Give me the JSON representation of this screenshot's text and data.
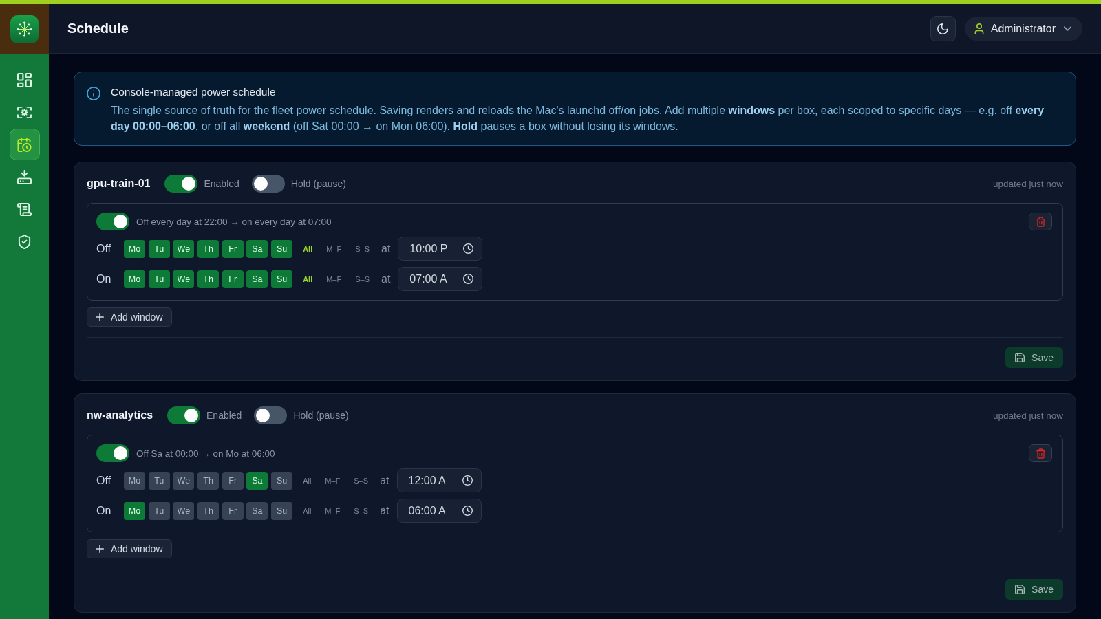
{
  "header": {
    "title": "Schedule",
    "user": {
      "name": "Administrator"
    }
  },
  "sidebar": {
    "items": [
      {
        "selected": false
      },
      {
        "selected": false
      },
      {
        "selected": true
      },
      {
        "selected": false
      },
      {
        "selected": false
      },
      {
        "selected": false
      }
    ]
  },
  "notice": {
    "title": "Console-managed power schedule",
    "text": "The single source of truth for the fleet power schedule. Saving renders and reloads the Mac's launchd off/on jobs. Add multiple **windows** per box, each scoped to specific days — e.g. off **every day 00:00–06:00**, or off all **weekend** (off Sat 00:00 → on Mon 06:00). **Hold** pauses a box without losing its windows."
  },
  "machines": [
    {
      "name": "gpu-train-01",
      "enabled": true,
      "enabled_label": "Enabled",
      "hold": false,
      "hold_label": "Hold (pause)",
      "updated": "updated just now",
      "windows": [
        {
          "active": true,
          "summary": "Off every day at 22:00 → on every day at 07:00",
          "rules": [
            {
              "label": "Off",
              "days": [
                {
                  "label": "Mo",
                  "selected": true
                },
                {
                  "label": "Tu",
                  "selected": true
                },
                {
                  "label": "We",
                  "selected": true
                },
                {
                  "label": "Th",
                  "selected": true
                },
                {
                  "label": "Fr",
                  "selected": true
                },
                {
                  "label": "Sa",
                  "selected": true
                },
                {
                  "label": "Su",
                  "selected": true
                }
              ],
              "presets": [
                {
                  "label": "All",
                  "selected": true
                },
                {
                  "label": "M–F",
                  "selected": false
                },
                {
                  "label": "S–S",
                  "selected": false
                }
              ],
              "at": "at",
              "time": "10:00 P"
            },
            {
              "label": "On",
              "days": [
                {
                  "label": "Mo",
                  "selected": true
                },
                {
                  "label": "Tu",
                  "selected": true
                },
                {
                  "label": "We",
                  "selected": true
                },
                {
                  "label": "Th",
                  "selected": true
                },
                {
                  "label": "Fr",
                  "selected": true
                },
                {
                  "label": "Sa",
                  "selected": true
                },
                {
                  "label": "Su",
                  "selected": true
                }
              ],
              "presets": [
                {
                  "label": "All",
                  "selected": true
                },
                {
                  "label": "M–F",
                  "selected": false
                },
                {
                  "label": "S–S",
                  "selected": false
                }
              ],
              "at": "at",
              "time": "07:00 A"
            }
          ]
        }
      ],
      "add_button": "Add window",
      "save_button": "Save"
    },
    {
      "name": "nw-analytics",
      "enabled": true,
      "enabled_label": "Enabled",
      "hold": false,
      "hold_label": "Hold (pause)",
      "updated": "updated just now",
      "windows": [
        {
          "active": true,
          "summary": "Off Sa at 00:00 → on Mo at 06:00",
          "rules": [
            {
              "label": "Off",
              "days": [
                {
                  "label": "Mo",
                  "selected": false
                },
                {
                  "label": "Tu",
                  "selected": false
                },
                {
                  "label": "We",
                  "selected": false
                },
                {
                  "label": "Th",
                  "selected": false
                },
                {
                  "label": "Fr",
                  "selected": false
                },
                {
                  "label": "Sa",
                  "selected": true
                },
                {
                  "label": "Su",
                  "selected": false
                }
              ],
              "presets": [
                {
                  "label": "All",
                  "selected": false
                },
                {
                  "label": "M–F",
                  "selected": false
                },
                {
                  "label": "S–S",
                  "selected": false
                }
              ],
              "at": "at",
              "time": "12:00 A"
            },
            {
              "label": "On",
              "days": [
                {
                  "label": "Mo",
                  "selected": true
                },
                {
                  "label": "Tu",
                  "selected": false
                },
                {
                  "label": "We",
                  "selected": false
                },
                {
                  "label": "Th",
                  "selected": false
                },
                {
                  "label": "Fr",
                  "selected": false
                },
                {
                  "label": "Sa",
                  "selected": false
                },
                {
                  "label": "Su",
                  "selected": false
                }
              ],
              "presets": [
                {
                  "label": "All",
                  "selected": false
                },
                {
                  "label": "M–F",
                  "selected": false
                },
                {
                  "label": "S–S",
                  "selected": false
                }
              ],
              "at": "at",
              "time": "06:00 A"
            }
          ]
        }
      ],
      "add_button": "Add window",
      "save_button": "Save"
    }
  ]
}
